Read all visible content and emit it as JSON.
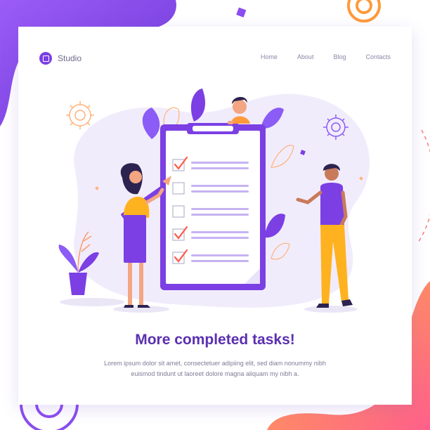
{
  "brand": {
    "name": "Studio"
  },
  "nav": {
    "items": [
      {
        "label": "Home"
      },
      {
        "label": "About"
      },
      {
        "label": "Blog"
      },
      {
        "label": "Contacts"
      }
    ]
  },
  "hero": {
    "headline": "More completed tasks!",
    "subtext": "Lorem ipsum dolor sit amet, consectetuer adipiing elit, sed diam nonummy nibh euismod tindunt ut laoreet dolore magna aliquam my nibh a."
  },
  "checklist": {
    "items": [
      {
        "checked": true
      },
      {
        "checked": false
      },
      {
        "checked": false
      },
      {
        "checked": true
      },
      {
        "checked": true
      }
    ]
  },
  "colors": {
    "primary": "#7b3fe4",
    "accent_orange": "#ff9a3c",
    "accent_pink": "#ff5f8a",
    "blob": "#f1ecfb"
  },
  "icons": [
    "gear-icon",
    "checkmark-icon",
    "pencil-icon",
    "plant-icon"
  ]
}
